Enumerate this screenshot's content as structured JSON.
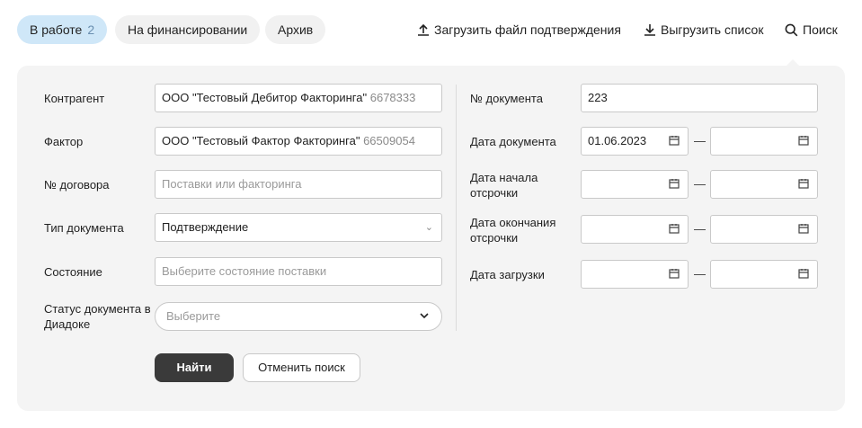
{
  "tabs": [
    {
      "label": "В работе",
      "count": "2"
    },
    {
      "label": "На финансировании"
    },
    {
      "label": "Архив"
    }
  ],
  "actions": {
    "upload": "Загрузить файл подтверждения",
    "download": "Выгрузить список",
    "search": "Поиск"
  },
  "filters_left": {
    "contragent": {
      "label": "Контрагент",
      "value": "ООО \"Тестовый Дебитор Факторинга\"",
      "inn": "6678333"
    },
    "factor": {
      "label": "Фактор",
      "value": "ООО \"Тестовый Фактор Факторинга\"",
      "inn": "66509054"
    },
    "contract": {
      "label": "№ договора",
      "placeholder": "Поставки или факторинга"
    },
    "doc_type": {
      "label": "Тип документа",
      "value": "Подтверждение"
    },
    "state": {
      "label": "Состояние",
      "placeholder": "Выберите состояние поставки"
    },
    "diadoc_status": {
      "label": "Статус документа в Диадоке",
      "placeholder": "Выберите"
    }
  },
  "filters_right": {
    "doc_number": {
      "label": "№ документа",
      "value": "223"
    },
    "doc_date": {
      "label": "Дата документа",
      "from": "01.06.2023",
      "to": ""
    },
    "deferral_start": {
      "label": "Дата начала отсрочки",
      "from": "",
      "to": ""
    },
    "deferral_end": {
      "label": "Дата окончания отсрочки",
      "from": "",
      "to": ""
    },
    "upload_date": {
      "label": "Дата загрузки",
      "from": "",
      "to": ""
    },
    "range_separator": "—"
  },
  "buttons": {
    "find": "Найти",
    "cancel": "Отменить поиск"
  }
}
